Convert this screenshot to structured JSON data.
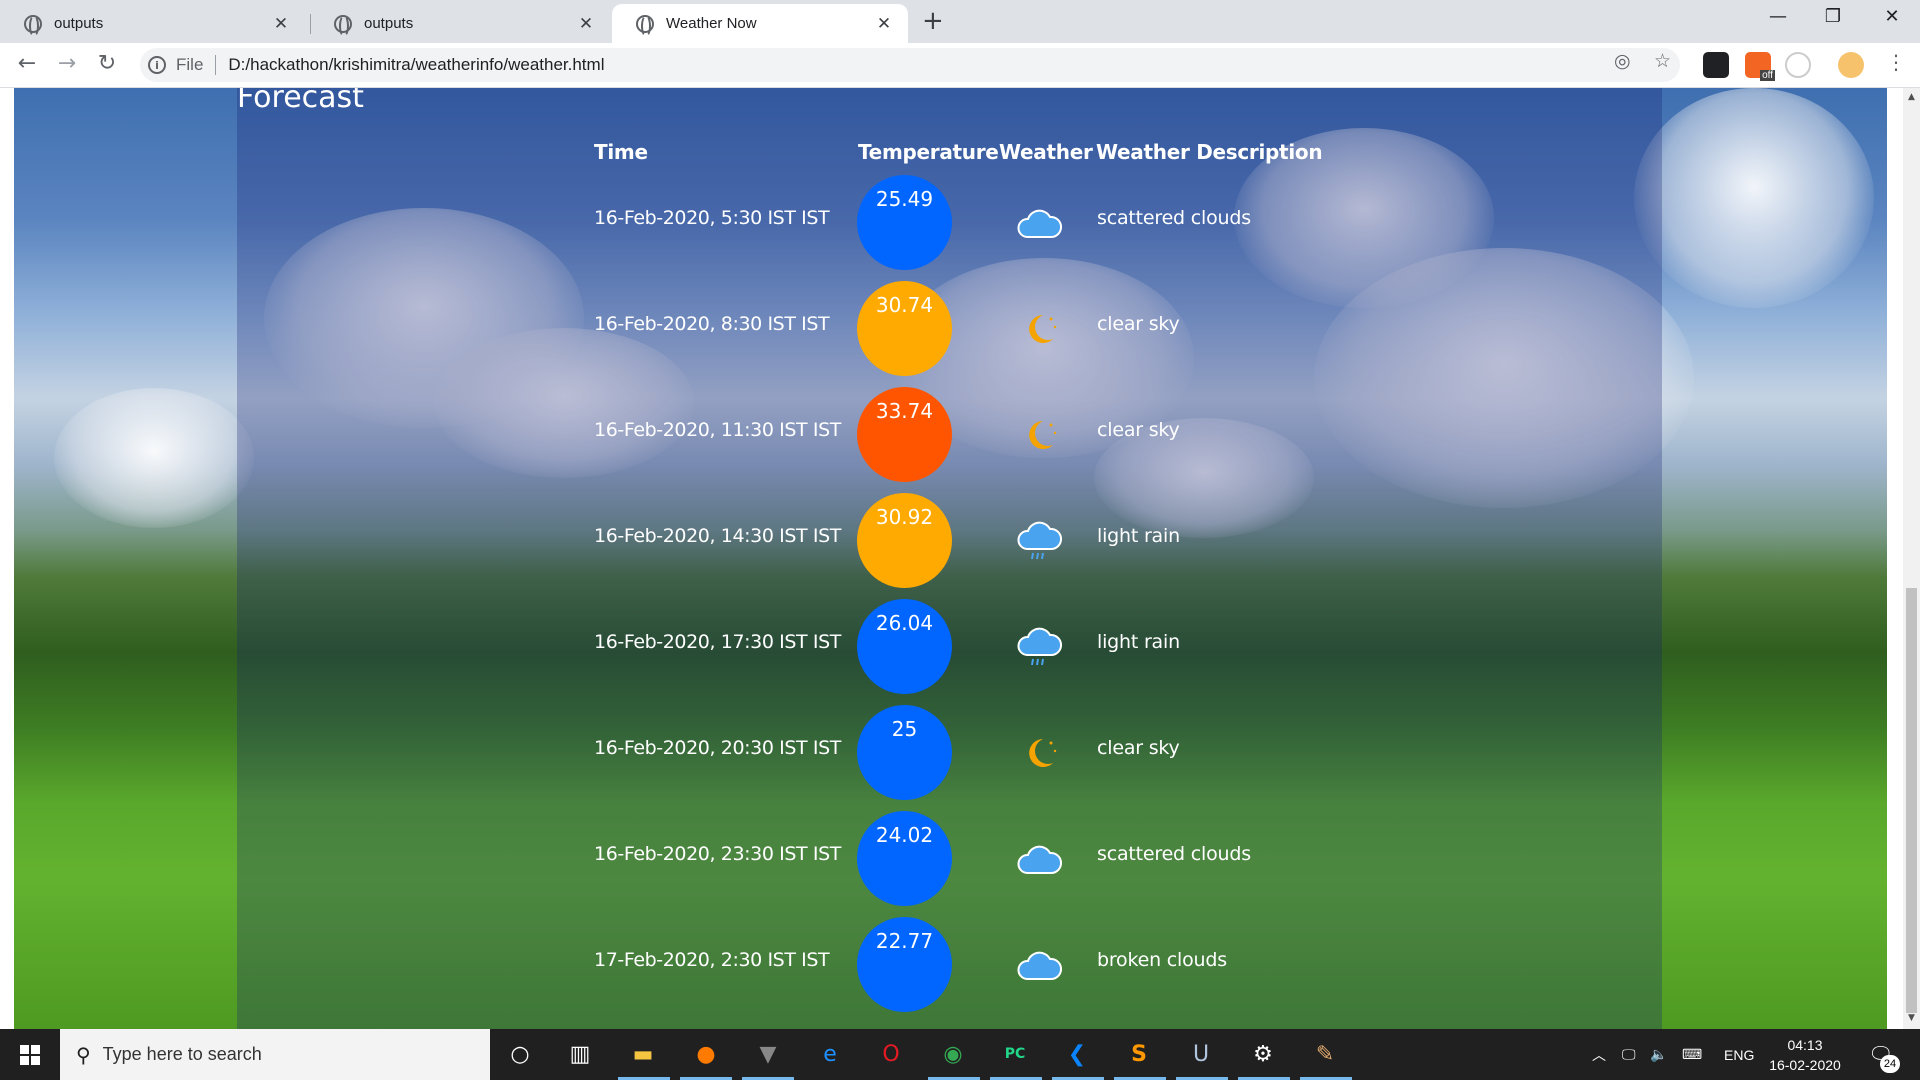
{
  "browser": {
    "tabs": [
      {
        "title": "outputs",
        "active": false
      },
      {
        "title": "outputs",
        "active": false
      },
      {
        "title": "Weather Now",
        "active": true
      }
    ],
    "omnibox": {
      "scheme_label": "File",
      "url": "D:/hackathon/krishimitra/weatherinfo/weather.html"
    },
    "extension_badge": "off"
  },
  "page": {
    "heading": "Forecast",
    "columns": {
      "time": "Time",
      "temperature": "Temperature",
      "weather": "Weather",
      "description": "Weather Description"
    },
    "rows": [
      {
        "time": "16-Feb-2020, 5:30 IST IST",
        "temperature": "25.49",
        "temp_color": "#0066ff",
        "icon": "cloud-icon",
        "description": "scattered clouds"
      },
      {
        "time": "16-Feb-2020, 8:30 IST IST",
        "temperature": "30.74",
        "temp_color": "#ffaa00",
        "icon": "moon-icon",
        "description": "clear sky"
      },
      {
        "time": "16-Feb-2020, 11:30 IST IST",
        "temperature": "33.74",
        "temp_color": "#ff5500",
        "icon": "moon-icon",
        "description": "clear sky"
      },
      {
        "time": "16-Feb-2020, 14:30 IST IST",
        "temperature": "30.92",
        "temp_color": "#ffaa00",
        "icon": "rain-cloud-icon",
        "description": "light rain"
      },
      {
        "time": "16-Feb-2020, 17:30 IST IST",
        "temperature": "26.04",
        "temp_color": "#0066ff",
        "icon": "rain-cloud-icon",
        "description": "light rain"
      },
      {
        "time": "16-Feb-2020, 20:30 IST IST",
        "temperature": "25",
        "temp_color": "#0066ff",
        "icon": "moon-icon",
        "description": "clear sky"
      },
      {
        "time": "16-Feb-2020, 23:30 IST IST",
        "temperature": "24.02",
        "temp_color": "#0066ff",
        "icon": "cloud-icon",
        "description": "scattered clouds"
      },
      {
        "time": "17-Feb-2020, 2:30 IST IST",
        "temperature": "22.77",
        "temp_color": "#0066ff",
        "icon": "cloud-icon",
        "description": "broken clouds"
      }
    ]
  },
  "taskbar": {
    "search_placeholder": "Type here to search",
    "language": "ENG",
    "time": "04:13",
    "date": "16-02-2020",
    "notification_count": "24"
  }
}
